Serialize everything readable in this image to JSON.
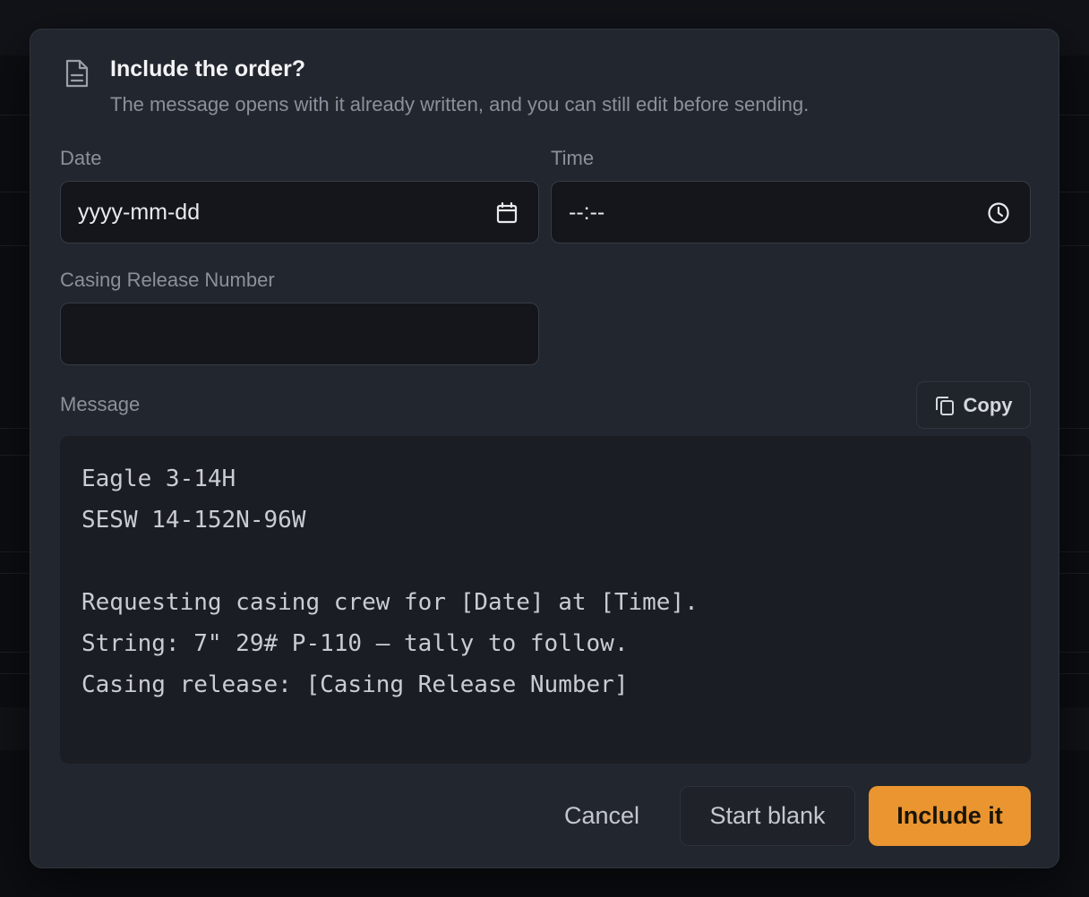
{
  "dialog": {
    "title": "Include the order?",
    "subtitle": "The message opens with it already written, and you can still edit before sending.",
    "icon": "document-icon"
  },
  "fields": {
    "date": {
      "label": "Date",
      "placeholder": "yyyy-mm-dd",
      "icon": "calendar-icon"
    },
    "time": {
      "label": "Time",
      "placeholder": "--:--",
      "icon": "clock-icon"
    },
    "casing_release": {
      "label": "Casing Release Number",
      "value": ""
    }
  },
  "message": {
    "label": "Message",
    "copy_label": "Copy",
    "body": "Eagle 3-14H\nSESW 14-152N-96W\n\nRequesting casing crew for [Date] at [Time].\nString: 7\" 29# P-110 — tally to follow.\nCasing release: [Casing Release Number]"
  },
  "actions": {
    "cancel": "Cancel",
    "start_blank": "Start blank",
    "include": "Include it"
  },
  "colors": {
    "accent": "#ea9530",
    "dialog_bg": "#22262e",
    "field_bg": "#14161b"
  }
}
